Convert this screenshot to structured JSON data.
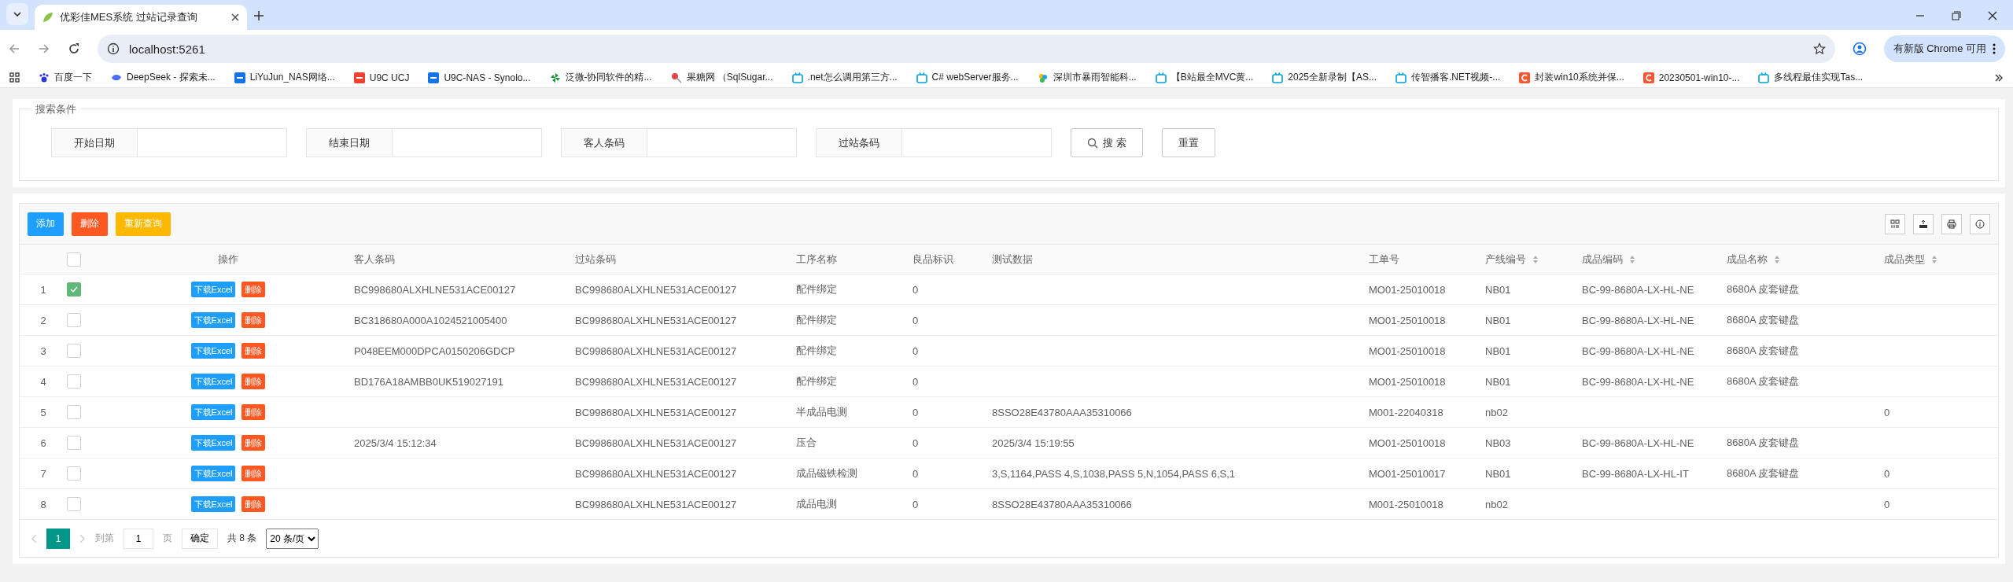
{
  "browser": {
    "tab_title": "优彩佳MES系统 过站记录查询",
    "url": "localhost:5261",
    "update_button": "有新版 Chrome 可用",
    "bookmarks": [
      {
        "label": "百度一下",
        "kind": "paw"
      },
      {
        "label": "DeepSeek - 探索未...",
        "kind": "whale"
      },
      {
        "label": "LiYuJun_NAS网络...",
        "kind": "nas"
      },
      {
        "label": "U9C UCJ",
        "kind": "red"
      },
      {
        "label": "U9C-NAS - Synolo...",
        "kind": "nas"
      },
      {
        "label": "泛微-协同软件的精...",
        "kind": "pinwheel"
      },
      {
        "label": "果糖网 （SqlSugar...",
        "kind": "candy"
      },
      {
        "label": ".net怎么调用第三方...",
        "kind": "tv"
      },
      {
        "label": "C# webServer服务...",
        "kind": "tv"
      },
      {
        "label": "深圳市暴雨智能科...",
        "kind": "cloud"
      },
      {
        "label": "【B站最全MVC黄...",
        "kind": "tv"
      },
      {
        "label": "2025全新录制【AS...",
        "kind": "tv"
      },
      {
        "label": "传智播客.NET视频-...",
        "kind": "tv"
      },
      {
        "label": "封装win10系统并保...",
        "kind": "c"
      },
      {
        "label": "20230501-win10-...",
        "kind": "c"
      },
      {
        "label": "多线程最佳实现Tas...",
        "kind": "tv"
      }
    ]
  },
  "search": {
    "legend": "搜索条件",
    "fields": [
      {
        "label": "开始日期"
      },
      {
        "label": "结束日期"
      },
      {
        "label": "客人条码"
      },
      {
        "label": "过站条码"
      }
    ],
    "search_button": "搜 索",
    "reset_button": "重置"
  },
  "toolbar": [
    {
      "label": "添加",
      "kind": "primary"
    },
    {
      "label": "删除",
      "kind": "danger"
    },
    {
      "label": "重新查询",
      "kind": "warning"
    }
  ],
  "table": {
    "header_checked": false,
    "action_column": "操作",
    "columns": [
      {
        "label": "客人条码",
        "sortable": false
      },
      {
        "label": "过站条码",
        "sortable": false
      },
      {
        "label": "工序名称",
        "sortable": false
      },
      {
        "label": "良品标识",
        "sortable": false
      },
      {
        "label": "测试数据",
        "sortable": false
      },
      {
        "label": "工单号",
        "sortable": false
      },
      {
        "label": "产线编号",
        "sortable": true
      },
      {
        "label": "成品编码",
        "sortable": true
      },
      {
        "label": "成品名称",
        "sortable": true
      },
      {
        "label": "成品类型",
        "sortable": true
      }
    ],
    "rows": [
      {
        "index": "1",
        "checked": true,
        "actions": [
          "下载Excel",
          "删除"
        ],
        "cells": [
          "BC998680ALXHLNE531ACE00127",
          "BC998680ALXHLNE531ACE00127",
          "配件绑定",
          "0",
          "",
          "MO01-25010018",
          "NB01",
          "BC-99-8680A-LX-HL-NE",
          "8680A 皮套键盘",
          ""
        ]
      },
      {
        "index": "2",
        "checked": false,
        "actions": [
          "下载Excel",
          "删除"
        ],
        "cells": [
          "BC318680A000A1024521005400",
          "BC998680ALXHLNE531ACE00127",
          "配件绑定",
          "0",
          "",
          "MO01-25010018",
          "NB01",
          "BC-99-8680A-LX-HL-NE",
          "8680A 皮套键盘",
          ""
        ]
      },
      {
        "index": "3",
        "checked": false,
        "actions": [
          "下载Excel",
          "删除"
        ],
        "cells": [
          "P048EEM000DPCA0150206GDCP",
          "BC998680ALXHLNE531ACE00127",
          "配件绑定",
          "0",
          "",
          "MO01-25010018",
          "NB01",
          "BC-99-8680A-LX-HL-NE",
          "8680A 皮套键盘",
          ""
        ]
      },
      {
        "index": "4",
        "checked": false,
        "actions": [
          "下载Excel",
          "删除"
        ],
        "cells": [
          "BD176A18AMBB0UK519027191",
          "BC998680ALXHLNE531ACE00127",
          "配件绑定",
          "0",
          "",
          "MO01-25010018",
          "NB01",
          "BC-99-8680A-LX-HL-NE",
          "8680A 皮套键盘",
          ""
        ]
      },
      {
        "index": "5",
        "checked": false,
        "actions": [
          "下载Excel",
          "删除"
        ],
        "cells": [
          "",
          "BC998680ALXHLNE531ACE00127",
          "半成品电测",
          "0",
          "8SSO28E43780AAA35310066",
          "M001-22040318",
          "nb02",
          "",
          "",
          "0"
        ]
      },
      {
        "index": "6",
        "checked": false,
        "actions": [
          "下载Excel",
          "删除"
        ],
        "cells": [
          "2025/3/4 15:12:34",
          "BC998680ALXHLNE531ACE00127",
          "压合",
          "0",
          "2025/3/4 15:19:55",
          "MO01-25010018",
          "NB03",
          "BC-99-8680A-LX-HL-NE",
          "8680A 皮套键盘",
          ""
        ]
      },
      {
        "index": "7",
        "checked": false,
        "actions": [
          "下载Excel",
          "删除"
        ],
        "cells": [
          "",
          "BC998680ALXHLNE531ACE00127",
          "成品磁铁检测",
          "0",
          "3,S,1164,PASS 4,S,1038,PASS 5,N,1054,PASS 6,S,1",
          "MO01-25010017",
          "NB01",
          "BC-99-8680A-LX-HL-IT",
          "8680A 皮套键盘",
          "0"
        ]
      },
      {
        "index": "8",
        "checked": false,
        "actions": [
          "下载Excel",
          "删除"
        ],
        "cells": [
          "",
          "BC998680ALXHLNE531ACE00127",
          "成品电测",
          "0",
          "8SSO28E43780AAA35310066",
          "M001-25010018",
          "nb02",
          "",
          "",
          "0"
        ]
      }
    ]
  },
  "pagination": {
    "pages": [
      {
        "label": "1",
        "selected": true
      }
    ],
    "goto_label": "到第",
    "goto_value": "1",
    "page_unit": "页",
    "confirm_button": "确定",
    "total": "共 8 条",
    "page_size": "20 条/页"
  }
}
